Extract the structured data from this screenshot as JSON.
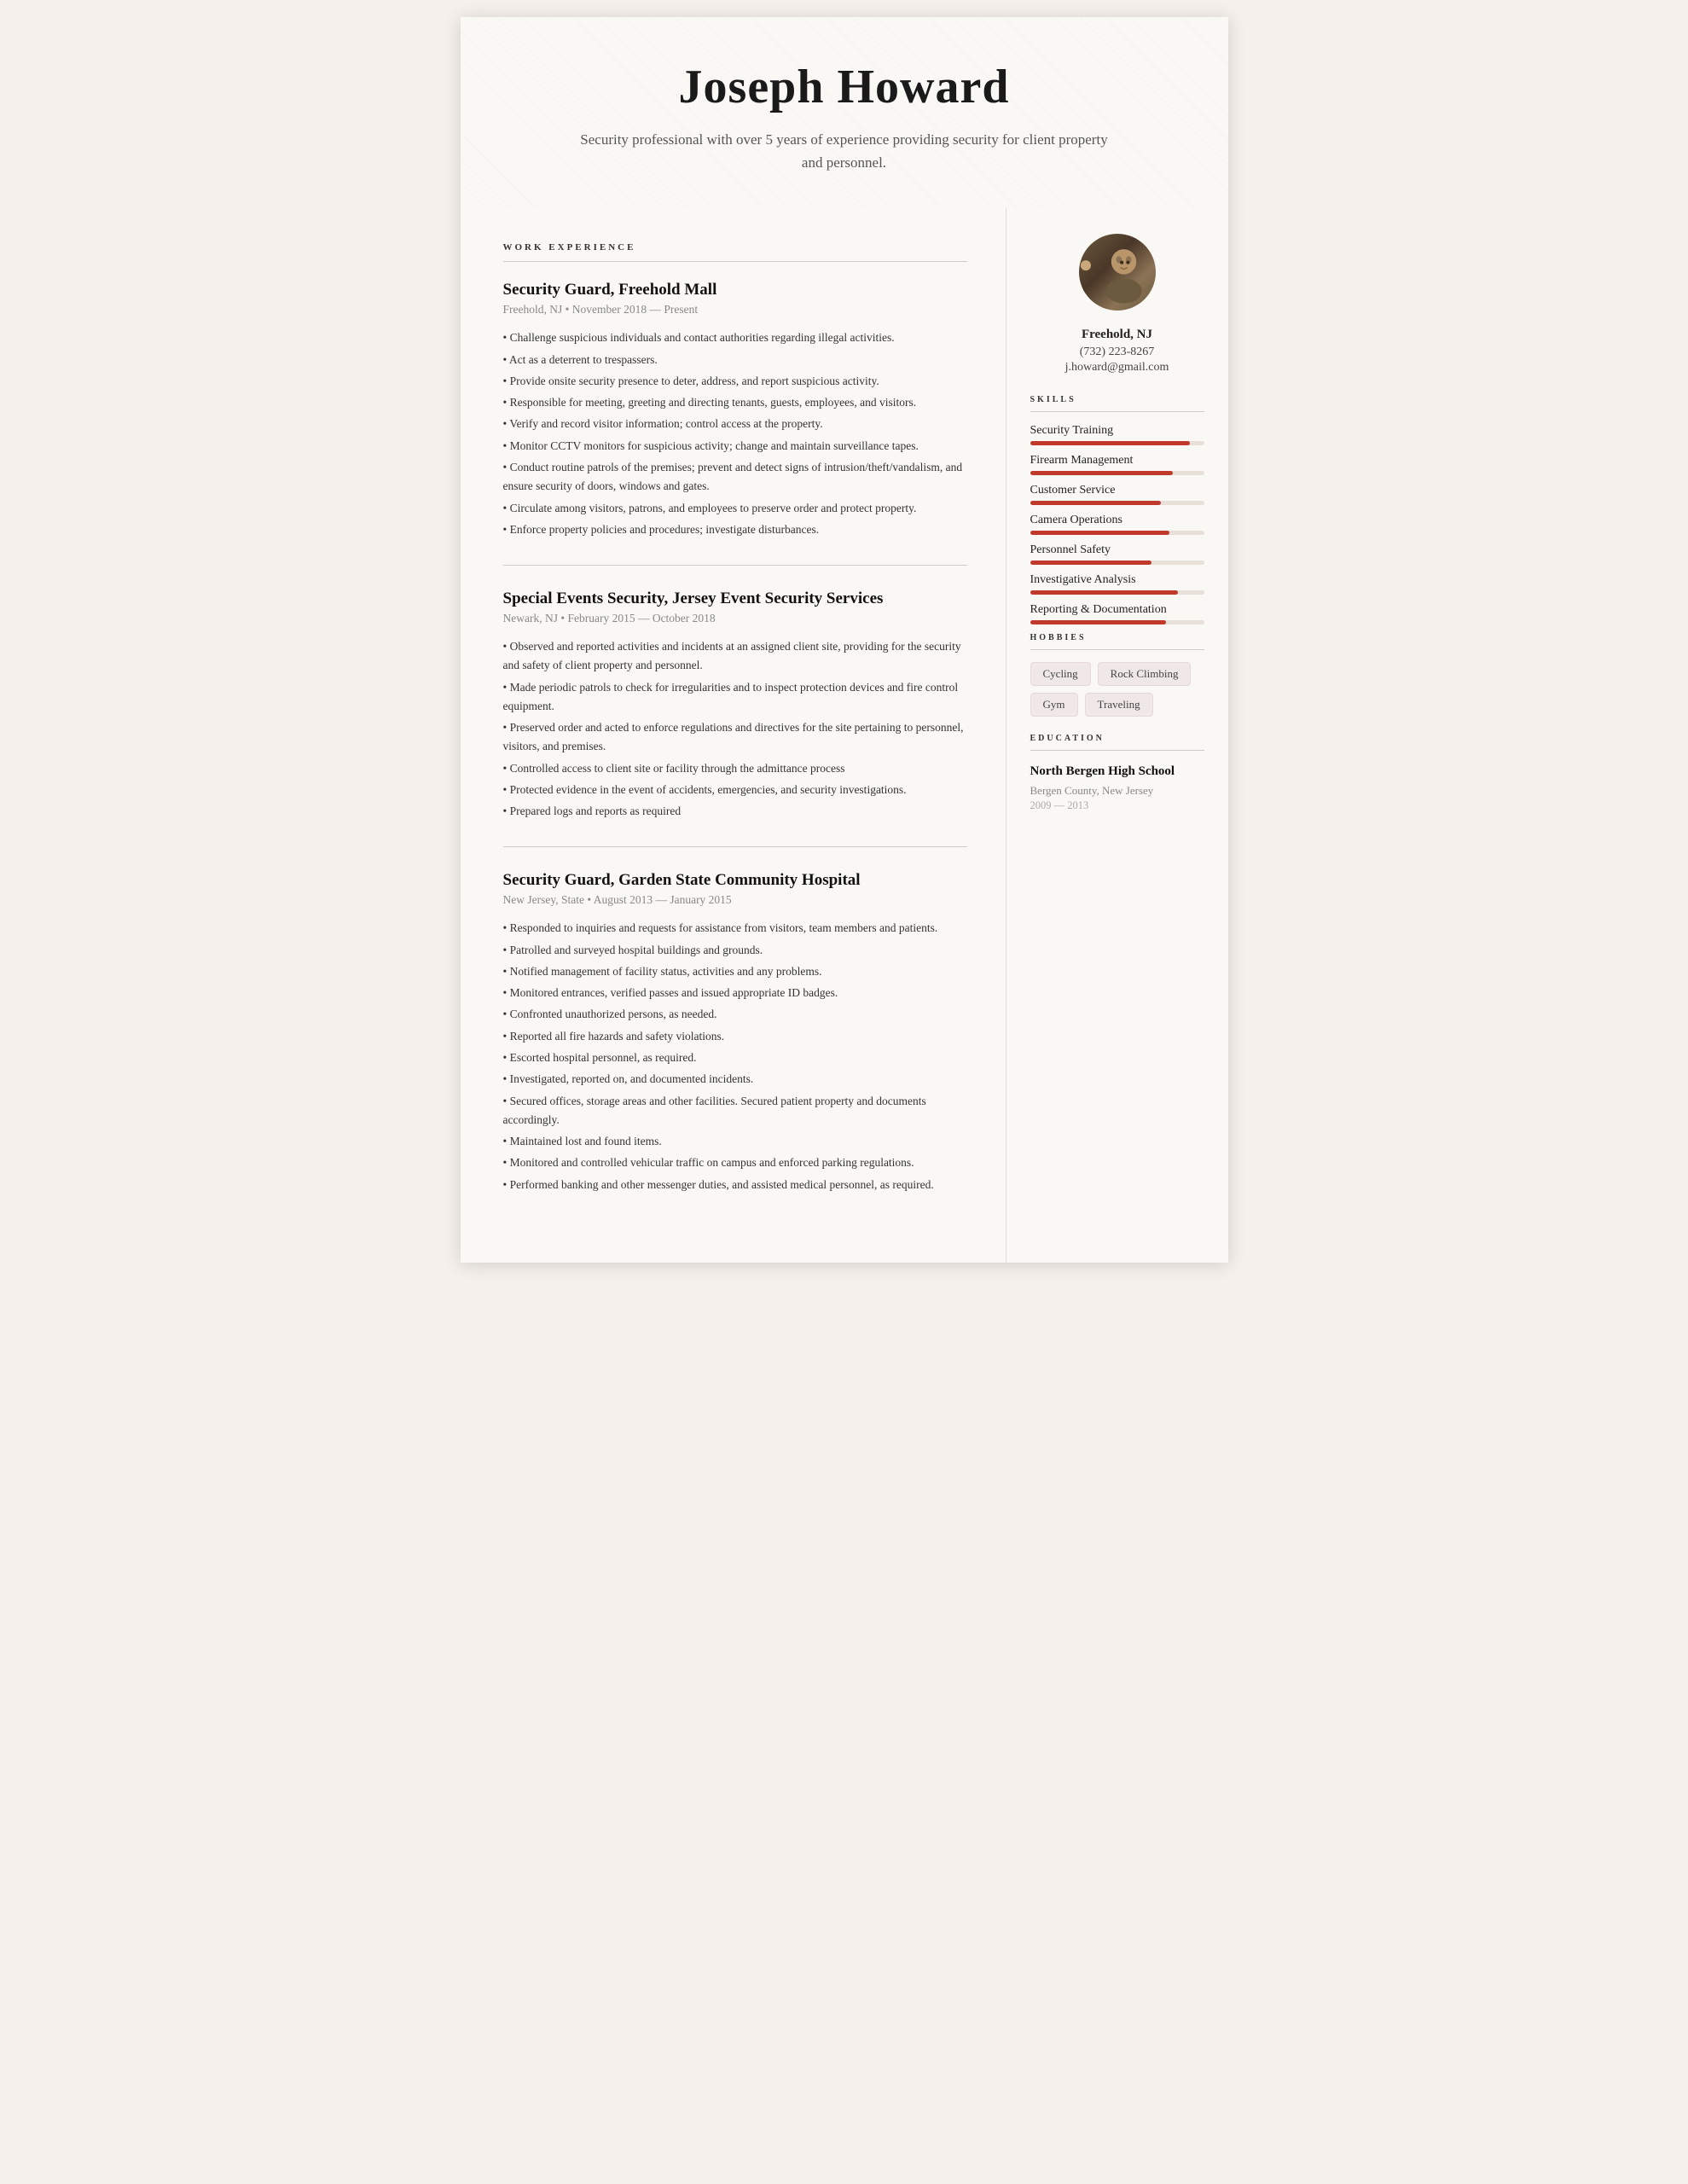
{
  "header": {
    "name": "Joseph Howard",
    "subtitle": "Security professional with over 5 years of experience providing security for client property and personnel."
  },
  "main": {
    "work_experience_label": "WORK EXPERIENCE",
    "jobs": [
      {
        "title": "Security Guard, Freehold Mall",
        "meta": "Freehold, NJ • November 2018 — Present",
        "bullets": [
          "• Challenge suspicious individuals and contact authorities regarding illegal activities.",
          "• Act as a deterrent to trespassers.",
          "• Provide onsite security presence to deter, address, and report suspicious activity.",
          "• Responsible for meeting, greeting and directing tenants, guests, employees, and visitors.",
          "• Verify and record visitor information; control access at the property.",
          "• Monitor CCTV monitors for suspicious activity; change and maintain surveillance tapes.",
          "• Conduct routine patrols of the premises; prevent and detect signs of intrusion/theft/vandalism, and ensure security of doors, windows and gates.",
          "• Circulate among visitors, patrons, and employees to preserve order and protect property.",
          "• Enforce property policies and procedures; investigate disturbances."
        ]
      },
      {
        "title": "Special Events Security, Jersey Event Security Services",
        "meta": "Newark, NJ • February 2015 — October 2018",
        "bullets": [
          "• Observed and reported activities and incidents at an assigned client site, providing for the security and safety of client property and personnel.",
          "• Made periodic patrols to check for irregularities and to inspect protection devices and fire control equipment.",
          "• Preserved order and acted to enforce regulations and directives for the site pertaining to personnel, visitors, and premises.",
          "• Controlled access to client site or facility through the admittance process",
          "• Protected evidence in the event of accidents, emergencies, and security investigations.",
          "• Prepared logs and reports as required"
        ]
      },
      {
        "title": "Security Guard, Garden State Community Hospital",
        "meta": "New Jersey, State • August 2013 — January 2015",
        "bullets": [
          "• Responded to inquiries and requests for assistance from visitors, team members and patients.",
          "• Patrolled and surveyed hospital buildings and grounds.",
          "• Notified management of facility status, activities and any problems.",
          "• Monitored entrances, verified passes and issued appropriate ID badges.",
          "• Confronted unauthorized persons, as needed.",
          "• Reported all fire hazards and safety violations.",
          "• Escorted hospital personnel, as required.",
          "• Investigated, reported on, and documented incidents.",
          "• Secured offices, storage areas and other facilities. Secured patient property and documents accordingly.",
          "• Maintained lost and found items.",
          "• Monitored and controlled vehicular traffic on campus and enforced parking regulations.",
          "• Performed banking and other messenger duties, and assisted medical personnel, as required."
        ]
      }
    ]
  },
  "sidebar": {
    "contact": {
      "location": "Freehold, NJ",
      "phone": "(732) 223-8267",
      "email": "j.howard@gmail.com"
    },
    "skills_label": "SKILLS",
    "skills": [
      {
        "name": "Security Training",
        "pct": 92
      },
      {
        "name": "Firearm Management",
        "pct": 82
      },
      {
        "name": "Customer Service",
        "pct": 75
      },
      {
        "name": "Camera Operations",
        "pct": 80
      },
      {
        "name": "Personnel Safety",
        "pct": 70
      },
      {
        "name": "Investigative Analysis",
        "pct": 85
      },
      {
        "name": "Reporting & Documentation",
        "pct": 78
      }
    ],
    "hobbies_label": "HOBBIES",
    "hobbies": [
      "Cycling",
      "Rock Climbing",
      "Gym",
      "Traveling"
    ],
    "education_label": "EDUCATION",
    "education": [
      {
        "school": "North Bergen High School",
        "location": "Bergen County, New Jersey",
        "years": "2009 — 2013"
      }
    ]
  }
}
